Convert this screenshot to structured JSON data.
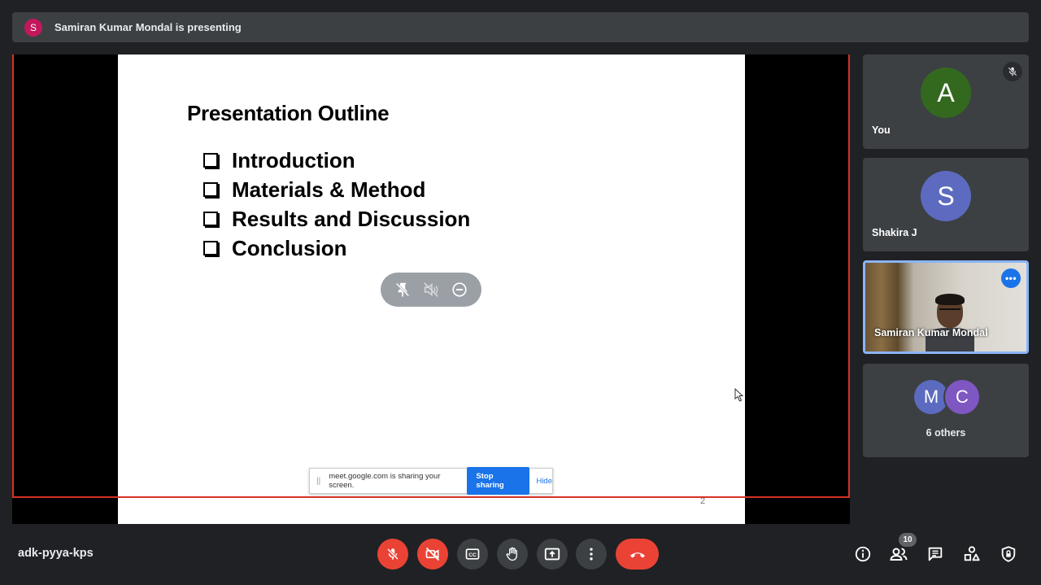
{
  "banner": {
    "avatar_letter": "S",
    "text": "Samiran Kumar Mondal is presenting"
  },
  "slide": {
    "title": "Presentation Outline",
    "bullets": [
      "Introduction",
      "Materials & Method",
      "Results and Discussion",
      "Conclusion"
    ],
    "page_number": "2"
  },
  "share_bar": {
    "message": "meet.google.com is sharing your screen.",
    "stop_label": "Stop sharing",
    "hide_label": "Hide"
  },
  "participants": [
    {
      "avatar_letter": "A",
      "name": "You",
      "avatar_color": "#33691e",
      "muted": true
    },
    {
      "avatar_letter": "S",
      "name": "Shakira J",
      "avatar_color": "#5c6bc0"
    },
    {
      "name": "Samiran Kumar Mondal",
      "video": true
    }
  ],
  "others": {
    "letters": [
      "M",
      "C"
    ],
    "colors": [
      "#5c6bc0",
      "#7e57c2"
    ],
    "label": "6 others"
  },
  "meeting": {
    "code": "adk-pyya-kps",
    "participant_count": "10"
  },
  "colors": {
    "accent": "#1a73e8",
    "danger": "#ea4335",
    "tile": "#3c4043",
    "background": "#202124"
  }
}
